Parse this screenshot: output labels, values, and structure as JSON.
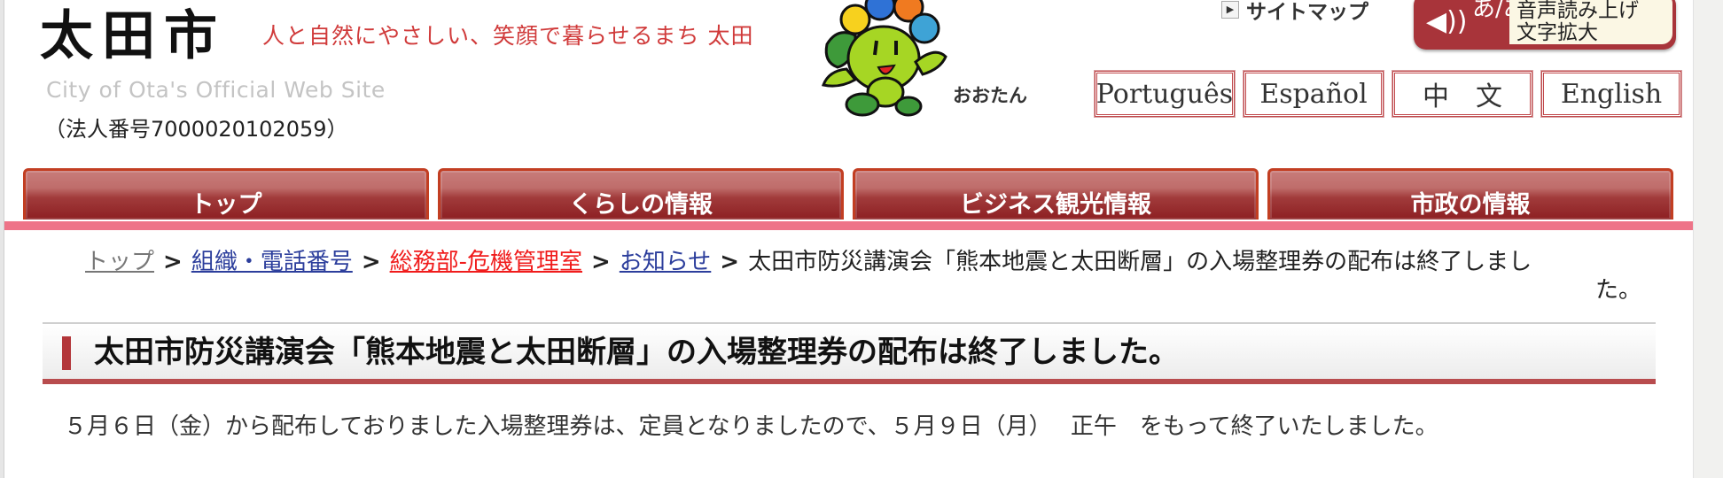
{
  "header": {
    "logo_title": "太田市",
    "slogan": "人と自然にやさしい、笑顔で暮らせるまち 太田",
    "site_name_en": "City of Ota's Official Web Site",
    "corporate_number": "（法人番号7000020102059）",
    "mascot_name": "おおたん",
    "sitemap_label": "サイトマップ",
    "voice_button": {
      "line1": "音声読み上げ",
      "line2": "文字拡大",
      "kana_icon": "あ/あ"
    },
    "languages": [
      "Português",
      "Español",
      "中　文",
      "English"
    ]
  },
  "nav": {
    "tabs": [
      "トップ",
      "くらしの情報",
      "ビジネス観光情報",
      "市政の情報"
    ]
  },
  "breadcrumb": {
    "separator": ">",
    "items": [
      {
        "label": "トップ"
      },
      {
        "label": "組織・電話番号"
      },
      {
        "label": "総務部-危機管理室"
      },
      {
        "label": "お知らせ"
      }
    ],
    "current_line1": "太田市防災講演会「熊本地震と太田断層」の入場整理券の配布は終了しまし",
    "current_line2": "た。"
  },
  "article": {
    "title": "太田市防災講演会「熊本地震と太田断層」の入場整理券の配布は終了しました。",
    "body": "５月６日（金）から配布しておりました入場整理券は、定員となりましたので、５月９日（月）　 正午　をもって終了いたしました。"
  },
  "colors": {
    "accent_red": "#b3363a",
    "nav_stripe_pink": "#ee7488",
    "slogan_red": "#d03a3a",
    "link_blue": "#2c3e9c",
    "dept_link_red": "#f01c1c"
  }
}
